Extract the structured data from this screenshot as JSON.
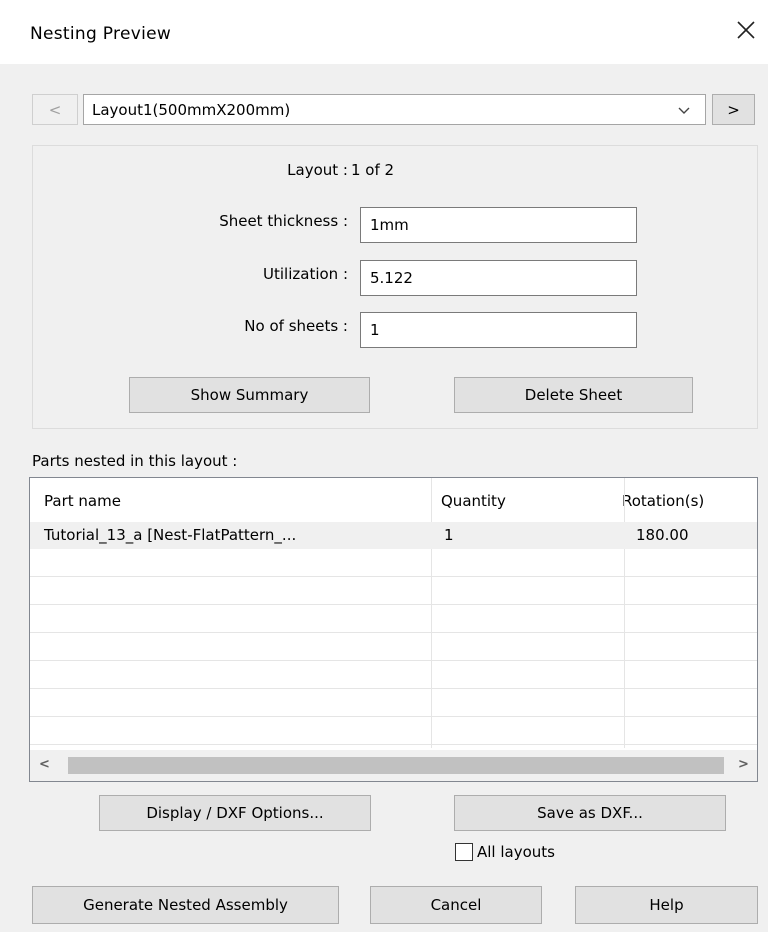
{
  "window": {
    "title": "Nesting Preview",
    "close_glyph": "✕"
  },
  "nav": {
    "prev_label": "<",
    "next_label": ">",
    "layout_selected": "Layout1(500mmX200mm)",
    "dropdown_glyph": "⌵"
  },
  "info": {
    "layout_label": "Layout :",
    "layout_value": "1 of 2",
    "thickness_label": "Sheet thickness :",
    "thickness_value": "1mm",
    "utilization_label": "Utilization :",
    "utilization_value": "5.122",
    "sheets_label": "No of sheets :",
    "sheets_value": "1",
    "show_summary": "Show Summary",
    "delete_sheet": "Delete Sheet"
  },
  "parts": {
    "caption": "Parts nested in this layout :",
    "columns": [
      "Part name",
      "Quantity",
      "Rotation(s)"
    ],
    "rows": [
      {
        "name": "Tutorial_13_a [Nest-FlatPattern_...",
        "quantity": "1",
        "rotation": "180.00"
      }
    ],
    "scroll_left": "<",
    "scroll_right": ">"
  },
  "actions": {
    "display_dxf": "Display / DXF Options...",
    "save_dxf": "Save as DXF...",
    "all_layouts": "All layouts",
    "all_layouts_checked": false,
    "generate": "Generate Nested Assembly",
    "cancel": "Cancel",
    "help": "Help"
  }
}
